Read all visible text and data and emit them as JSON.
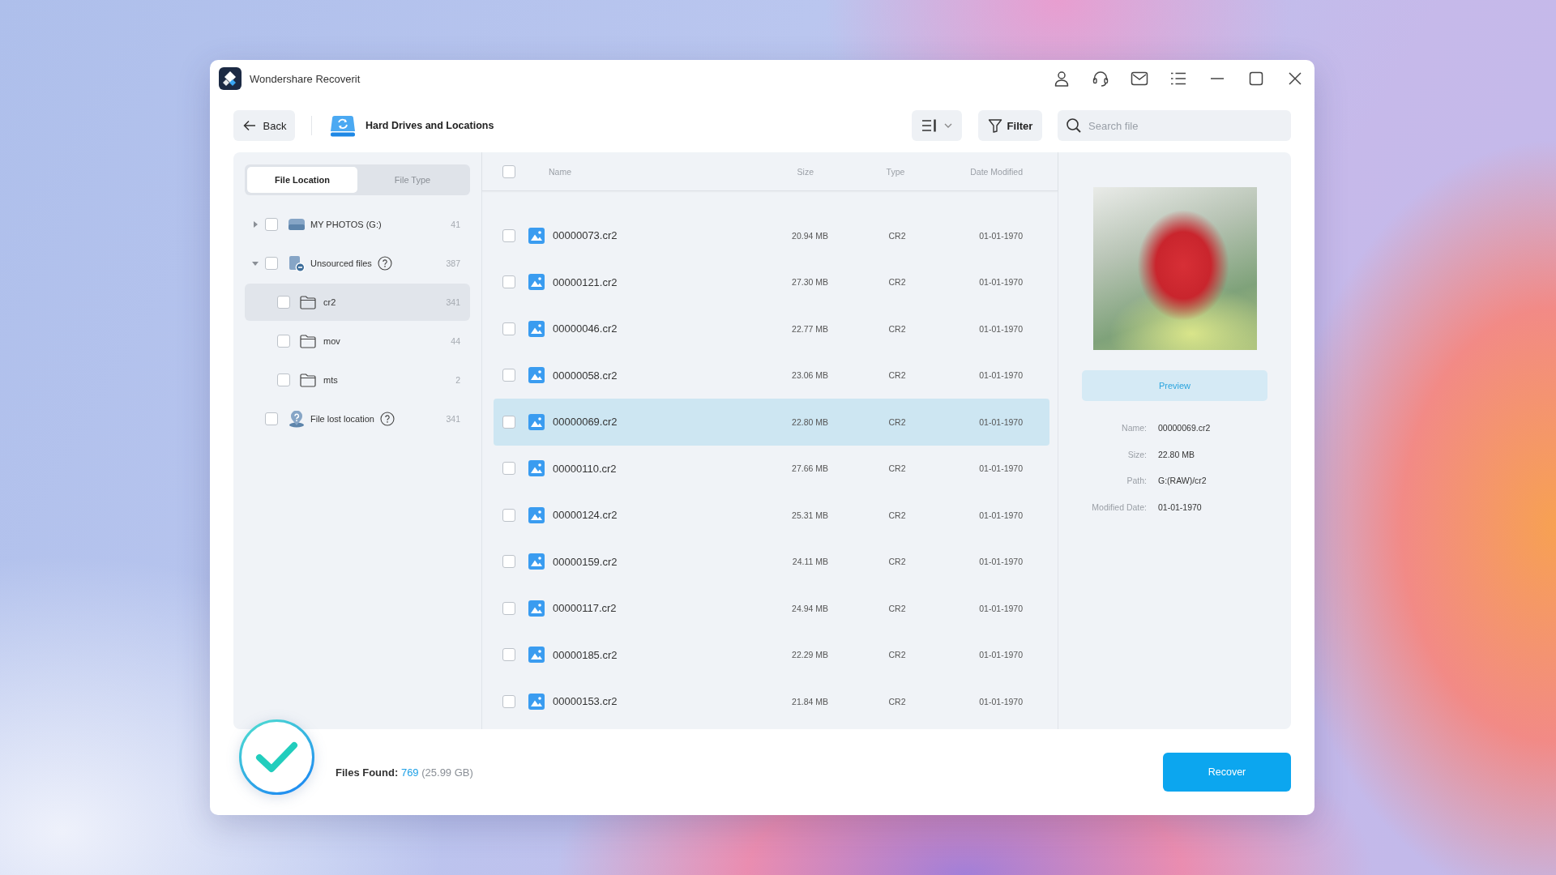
{
  "window": {
    "title": "Wondershare Recoverit"
  },
  "toolbar": {
    "back": "Back",
    "location": "Hard Drives and Locations",
    "filter": "Filter",
    "search": {
      "placeholder": "Search file"
    }
  },
  "sidebar": {
    "tabs": [
      {
        "label": "File Location",
        "selected": true
      },
      {
        "label": "File Type",
        "selected": false
      }
    ],
    "tree": [
      {
        "kind": "drive",
        "label": "MY PHOTOS (G:)",
        "count": "41",
        "expanded": false,
        "checked": false,
        "selected": false,
        "help": false
      },
      {
        "kind": "unsourced",
        "label": "Unsourced files",
        "count": "387",
        "expanded": true,
        "checked": false,
        "selected": false,
        "help": true,
        "children": [
          {
            "kind": "folder",
            "label": "cr2",
            "count": "341",
            "checked": false,
            "selected": true
          },
          {
            "kind": "folder",
            "label": "mov",
            "count": "44",
            "checked": false,
            "selected": false
          },
          {
            "kind": "folder",
            "label": "mts",
            "count": "2",
            "checked": false,
            "selected": false
          }
        ]
      },
      {
        "kind": "lost",
        "label": "File lost location",
        "count": "341",
        "checked": false,
        "selected": false,
        "help": true
      }
    ]
  },
  "table": {
    "columns": [
      "Name",
      "Size",
      "Type",
      "Date Modified"
    ],
    "all_checked": false,
    "rows": [
      {
        "name": "00000073.cr2",
        "size": "20.94 MB",
        "type": "CR2",
        "date": "01-01-1970",
        "checked": false,
        "selected": false
      },
      {
        "name": "00000121.cr2",
        "size": "27.30 MB",
        "type": "CR2",
        "date": "01-01-1970",
        "checked": false,
        "selected": false
      },
      {
        "name": "00000046.cr2",
        "size": "22.77 MB",
        "type": "CR2",
        "date": "01-01-1970",
        "checked": false,
        "selected": false
      },
      {
        "name": "00000058.cr2",
        "size": "23.06 MB",
        "type": "CR2",
        "date": "01-01-1970",
        "checked": false,
        "selected": false
      },
      {
        "name": "00000069.cr2",
        "size": "22.80 MB",
        "type": "CR2",
        "date": "01-01-1970",
        "checked": false,
        "selected": true
      },
      {
        "name": "00000110.cr2",
        "size": "27.66 MB",
        "type": "CR2",
        "date": "01-01-1970",
        "checked": false,
        "selected": false
      },
      {
        "name": "00000124.cr2",
        "size": "25.31 MB",
        "type": "CR2",
        "date": "01-01-1970",
        "checked": false,
        "selected": false
      },
      {
        "name": "00000159.cr2",
        "size": "24.11 MB",
        "type": "CR2",
        "date": "01-01-1970",
        "checked": false,
        "selected": false
      },
      {
        "name": "00000117.cr2",
        "size": "24.94 MB",
        "type": "CR2",
        "date": "01-01-1970",
        "checked": false,
        "selected": false
      },
      {
        "name": "00000185.cr2",
        "size": "22.29 MB",
        "type": "CR2",
        "date": "01-01-1970",
        "checked": false,
        "selected": false
      },
      {
        "name": "00000153.cr2",
        "size": "21.84 MB",
        "type": "CR2",
        "date": "01-01-1970",
        "checked": false,
        "selected": false
      }
    ]
  },
  "preview": {
    "button": "Preview",
    "details": [
      {
        "label": "Name:",
        "value": "00000069.cr2"
      },
      {
        "label": "Size:",
        "value": "22.80 MB"
      },
      {
        "label": "Path:",
        "value": "G:(RAW)/cr2"
      },
      {
        "label": "Modified Date:",
        "value": "01-01-1970"
      }
    ]
  },
  "footer": {
    "label": "Files Found:",
    "count": "769",
    "size": "(25.99 GB)",
    "recover": "Recover"
  }
}
